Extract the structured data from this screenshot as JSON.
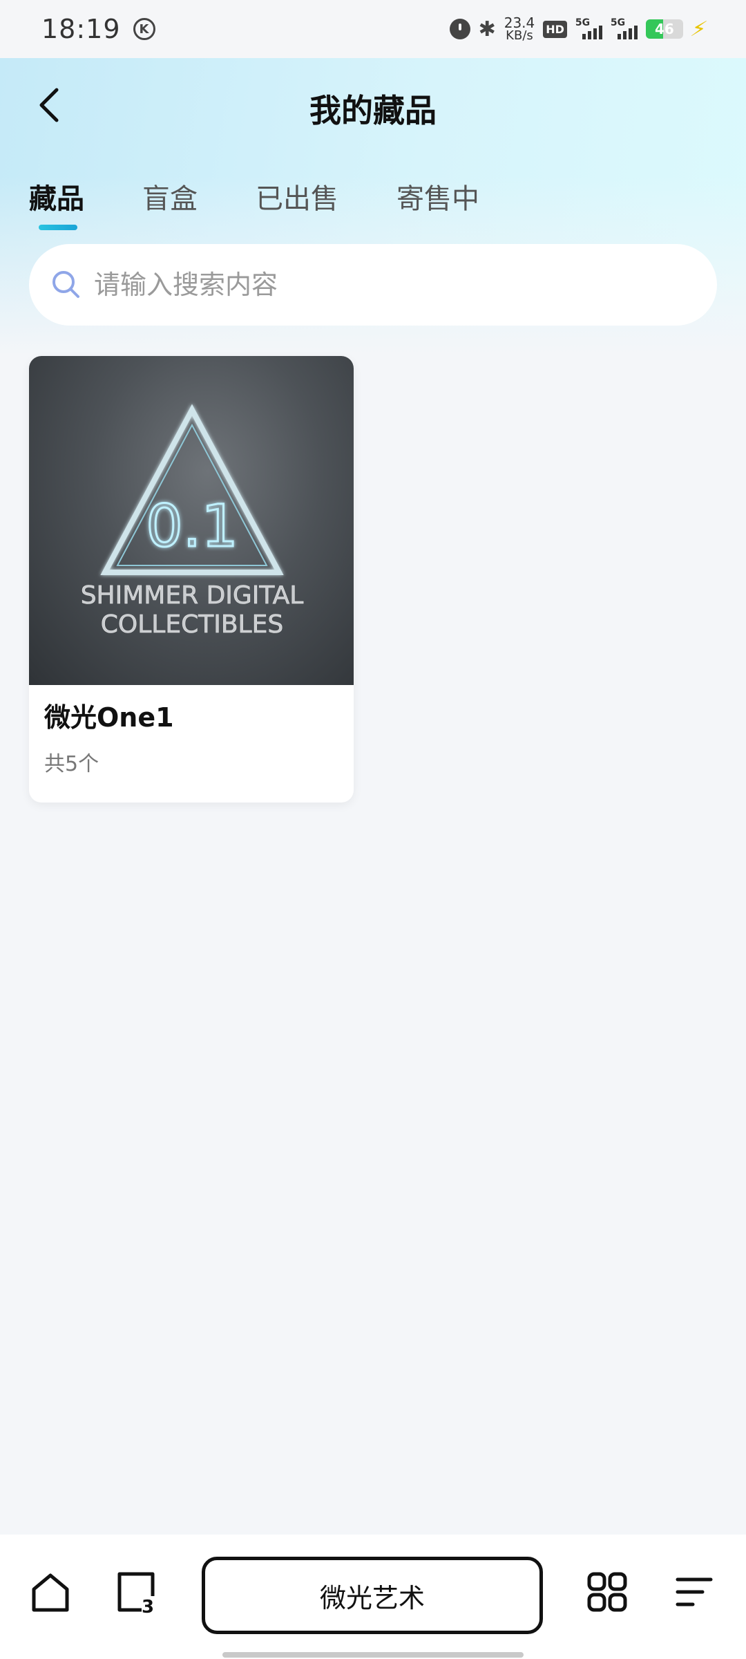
{
  "status_bar": {
    "time": "18:19",
    "k_badge": "K",
    "speed_value": "23.4",
    "speed_unit": "KB/s",
    "hd_label": "HD",
    "signal1_label": "5G",
    "signal2_label": "5G",
    "battery_level": "46"
  },
  "header": {
    "title": "我的藏品"
  },
  "tabs": [
    {
      "label": "藏品",
      "active": true
    },
    {
      "label": "盲盒",
      "active": false
    },
    {
      "label": "已出售",
      "active": false
    },
    {
      "label": "寄售中",
      "active": false
    }
  ],
  "search": {
    "placeholder": "请输入搜索内容",
    "value": ""
  },
  "collections": [
    {
      "name": "微光One1",
      "count": "共5个",
      "image_text_big": "0.1",
      "image_text_line1": "SHIMMER DIGITAL",
      "image_text_line2": "COLLECTIBLES"
    }
  ],
  "bottom_nav": {
    "app_name": "微光艺术",
    "tabs_count": "3"
  },
  "colors": {
    "accent": "#1fb3dc",
    "header_gradient_start": "#c5eaf8",
    "header_gradient_end": "#dcfafd",
    "page_background": "#f4f6f9"
  }
}
